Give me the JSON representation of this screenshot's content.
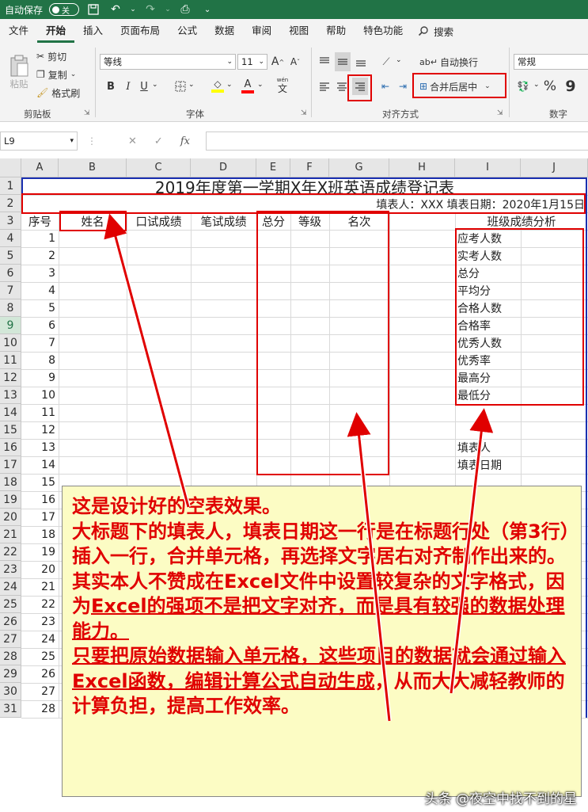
{
  "titlebar": {
    "autosave_label": "自动保存",
    "autosave_state": "关"
  },
  "menu": {
    "tabs": [
      "文件",
      "开始",
      "插入",
      "页面布局",
      "公式",
      "数据",
      "审阅",
      "视图",
      "帮助",
      "特色功能"
    ],
    "active": "开始",
    "search_label": "搜索"
  },
  "ribbon": {
    "clipboard": {
      "paste": "粘贴",
      "cut": "剪切",
      "copy": "复制",
      "format_painter": "格式刷",
      "group": "剪贴板"
    },
    "font": {
      "family": "等线",
      "size": "11",
      "bold": "B",
      "italic": "I",
      "underline": "U",
      "phonetic": "wén",
      "group": "字体"
    },
    "alignment": {
      "wrap_text": "自动换行",
      "merge_center": "合并后居中",
      "group": "对齐方式"
    },
    "number": {
      "format": "常规",
      "group": "数字"
    }
  },
  "formula_bar": {
    "name_box": "L9",
    "fx": "fx"
  },
  "sheet": {
    "columns": [
      "A",
      "B",
      "C",
      "D",
      "E",
      "F",
      "G",
      "H",
      "I",
      "J"
    ],
    "row_numbers": [
      "1",
      "2",
      "3",
      "4",
      "5",
      "6",
      "7",
      "8",
      "9",
      "10",
      "11",
      "12",
      "13",
      "14",
      "15",
      "16",
      "17",
      "18",
      "19",
      "20",
      "21",
      "22",
      "23",
      "24",
      "25",
      "26",
      "27",
      "28",
      "29",
      "30",
      "31"
    ],
    "selected_row": "9",
    "title": "2019年度第一学期X年X班英语成绩登记表",
    "subtitle": "填表人：XXX   填表日期：2020年1月15日",
    "headers": [
      "序号",
      "姓名",
      "口试成绩",
      "笔试成绩",
      "总分",
      "等级",
      "名次"
    ],
    "serials": [
      "1",
      "2",
      "3",
      "4",
      "5",
      "6",
      "7",
      "8",
      "9",
      "10",
      "11",
      "12",
      "13",
      "14",
      "15",
      "16",
      "17",
      "18",
      "19",
      "20",
      "21",
      "22",
      "23",
      "24",
      "25",
      "26",
      "27",
      "28"
    ],
    "analysis_title": "班级成绩分析",
    "analysis_items": [
      "应考人数",
      "实考人数",
      "总分",
      "平均分",
      "合格人数",
      "合格率",
      "优秀人数",
      "优秀率",
      "最高分",
      "最低分"
    ],
    "filler_label": "填表人",
    "fill_date_label": "填表日期"
  },
  "callout": {
    "p1": "这是设计好的空表效果。",
    "p2": "大标题下的填表人，填表日期这一行是在标题行处（第3行）插入一行，合并单元格，再选择文字居右对齐制作出来的。",
    "p3a": "其实本人不赞成在Excel文件中设置较复杂的文字格式，因为",
    "p3b": "Excel的强项不是把文字对齐，而是具有较强的数据处理能力。",
    "p4": "只要把原始数据输入单元格，这些项目的数据就会通过输入Excel函数，编辑计算公式自动生成",
    "p4b": "，从而大大减轻教师的计算负担，提高工作效率。"
  },
  "watermark": "头条 @夜空中找不到的星"
}
